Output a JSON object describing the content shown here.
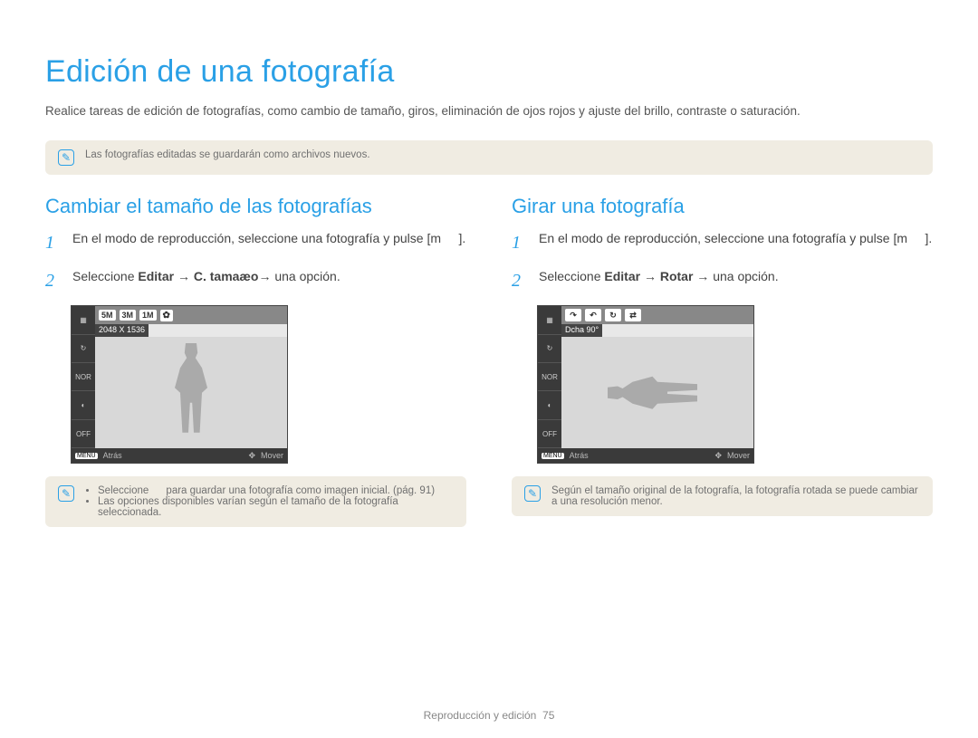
{
  "title": "Edición de una fotografía",
  "intro": "Realice tareas de edición de fotografías, como cambio de tamaño, giros, eliminación de ojos rojos y ajuste del brillo, contraste o saturación.",
  "top_note": "Las fotografías editadas se guardarán como archivos nuevos.",
  "left": {
    "heading": "Cambiar el tamaño de las fotografías",
    "step1": "En el modo de reproducción, seleccione una fotografía y pulse [m     ].",
    "step2_pre": "Seleccione ",
    "step2_editar": "Editar",
    "step2_arrow1": " → ",
    "step2_option": "C. tamaæo",
    "step2_arrow2": "→ una opción.",
    "screen": {
      "chips": [
        "5M",
        "3M",
        "1M"
      ],
      "label": "2048 X 1536",
      "back": "Atrás",
      "move": "Mover",
      "menu": "MENU"
    },
    "note_items": [
      "Seleccione      para guardar una fotografía como imagen inicial. (pág. 91)",
      "Las opciones disponibles varían según el tamaño de la fotografía seleccionada."
    ]
  },
  "right": {
    "heading": "Girar una fotografía",
    "step1": "En el modo de reproducción, seleccione una fotografía y pulse [m     ].",
    "step2_pre": "Seleccione ",
    "step2_editar": "Editar",
    "step2_arrow1": " → ",
    "step2_option": "Rotar",
    "step2_arrow2": " → una opción.",
    "screen": {
      "label": "Dcha 90°",
      "back": "Atrás",
      "move": "Mover",
      "menu": "MENU"
    },
    "note": "Según el tamaño original de la fotografía, la fotografía rotada se puede cambiar a una resolución menor."
  },
  "footer_section": "Reproducción y edición",
  "footer_page": "75"
}
